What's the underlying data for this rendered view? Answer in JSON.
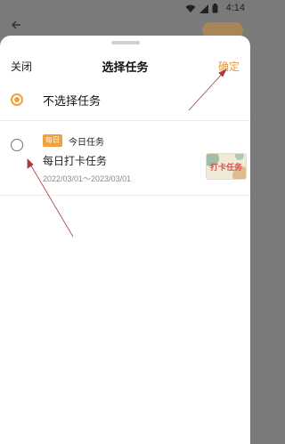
{
  "status_bar": {
    "time": "4:14"
  },
  "sheet": {
    "close_label": "关闭",
    "title": "选择任务",
    "confirm_label": "确定",
    "options": {
      "none_label": "不选择任务"
    },
    "task": {
      "tag": "每日",
      "category": "今日任务",
      "name": "每日打卡任务",
      "date_range": "2022/03/01～2023/03/01",
      "thumbnail_text": "打卡任务"
    }
  },
  "colors": {
    "accent": "#f0a13f",
    "annotation_arrow": "#a83a3a"
  }
}
